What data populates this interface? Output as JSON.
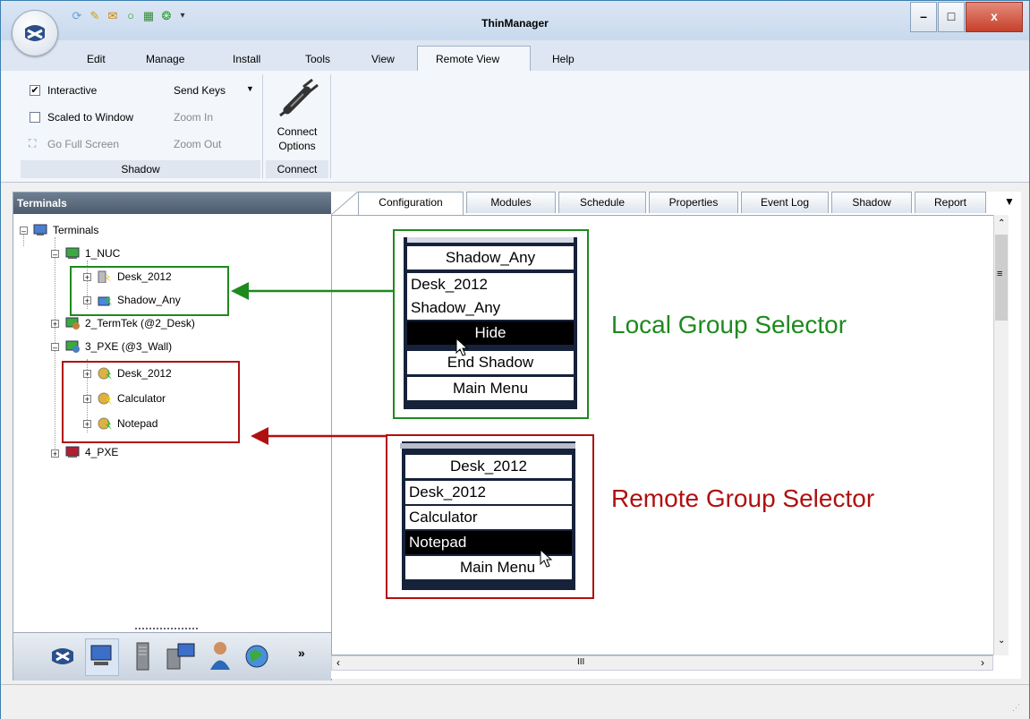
{
  "window": {
    "title": "ThinManager"
  },
  "window_controls": {
    "minimize": "–",
    "maximize": "□",
    "close": "x"
  },
  "menu": {
    "items": [
      "Edit",
      "Manage",
      "Install",
      "Tools",
      "View",
      "Remote View",
      "Help"
    ],
    "active": "Remote View"
  },
  "ribbon": {
    "shadow_group": {
      "label": "Shadow",
      "interactive": {
        "label": "Interactive",
        "checked": true
      },
      "scaled": {
        "label": "Scaled to Window",
        "checked": false
      },
      "fullscreen": "Go Full Screen",
      "send_keys": "Send Keys",
      "zoom_in": "Zoom In",
      "zoom_out": "Zoom Out"
    },
    "connect_group": {
      "label": "Connect",
      "button_line1": "Connect",
      "button_line2": "Options"
    }
  },
  "left_pane": {
    "title": "Terminals",
    "tree": [
      {
        "label": "Terminals",
        "icon": "terminal-root-icon"
      },
      {
        "label": "1_NUC",
        "icon": "terminal-green-icon"
      },
      {
        "label": "Desk_2012",
        "icon": "display-server-icon"
      },
      {
        "label": "Shadow_Any",
        "icon": "shadow-group-icon"
      },
      {
        "label": "2_TermTek (@2_Desk)",
        "icon": "terminal-user-icon"
      },
      {
        "label": "3_PXE (@3_Wall)",
        "icon": "terminal-user-icon"
      },
      {
        "label": "Desk_2012",
        "icon": "app-group-icon"
      },
      {
        "label": "Calculator",
        "icon": "app-group-icon"
      },
      {
        "label": "Notepad",
        "icon": "app-group-icon"
      },
      {
        "label": "4_PXE",
        "icon": "terminal-red-icon"
      }
    ],
    "bottom_more": "»"
  },
  "tabs": [
    "Configuration",
    "Modules",
    "Schedule",
    "Properties",
    "Event Log",
    "Shadow",
    "Report"
  ],
  "active_tab": "Configuration",
  "local_menu": {
    "title": "Shadow_Any",
    "items": [
      "Desk_2012",
      "Shadow_Any",
      "Hide",
      "End Shadow",
      "Main Menu"
    ],
    "highlighted": "Hide"
  },
  "remote_menu": {
    "title": "Desk_2012",
    "items": [
      "Desk_2012",
      "Calculator",
      "Notepad",
      "Main Menu"
    ],
    "highlighted": "Notepad"
  },
  "labels": {
    "local": "Local Group Selector",
    "remote": "Remote Group Selector"
  },
  "colors": {
    "local": "#1e8a1e",
    "remote": "#b01010",
    "title_bar": "#c8d9ee"
  },
  "scroll": {
    "h_thumb": "III",
    "v_thumb": "≡"
  }
}
